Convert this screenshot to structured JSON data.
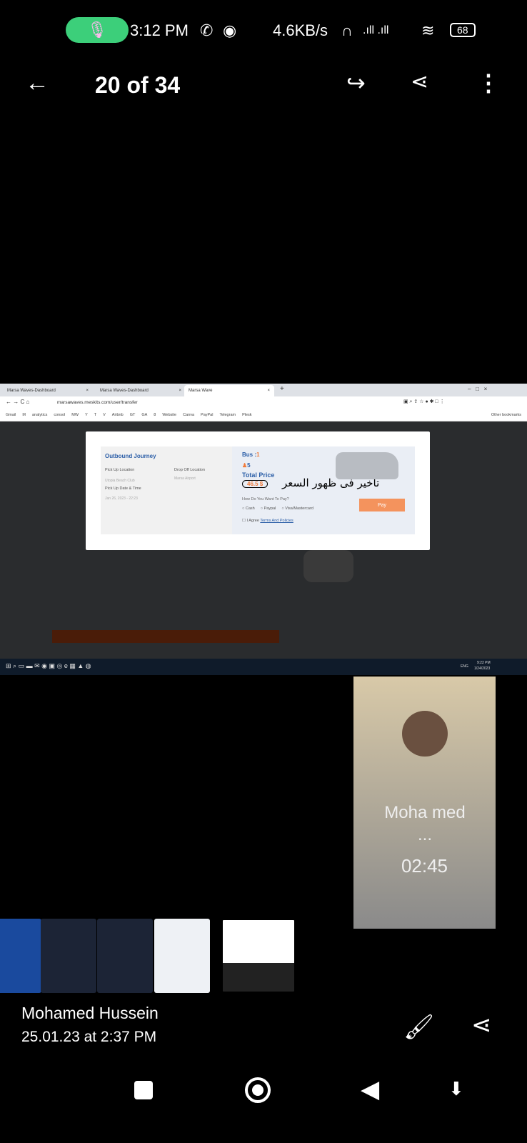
{
  "status_bar": {
    "time": "3:12 PM",
    "network_speed": "4.6KB/s",
    "battery": "68"
  },
  "viewer": {
    "counter": "20 of 34"
  },
  "browser": {
    "tabs": [
      {
        "label": "Marsa Waves-Dashboard"
      },
      {
        "label": "Marsa Waves-Dashboard"
      },
      {
        "label": "Marsa Wave"
      }
    ],
    "url": "marsawaves.meskits.com/user/transfer",
    "bookmarks": [
      "Gmail",
      "M",
      "analytics",
      "consol",
      "MW",
      "Y",
      "T",
      "V",
      "Airbnb",
      "GT",
      "GA",
      "8",
      "Website",
      "Canva",
      "PayPal",
      "Telegram",
      "Plesk"
    ],
    "other_bookmarks": "Other bookmarks"
  },
  "modal": {
    "title": "Outbound Journey",
    "pickup_label": "Pick Up Location",
    "pickup_value": "Utopia Beach Club",
    "dropoff_label": "Drop Off Location",
    "dropoff_value": "Marsa Airport",
    "datetime_label": "Pick Up Date & Time",
    "datetime_value": "Jan 26, 2023 - 22:23",
    "bus_label": "Bus :",
    "bus_value": "1",
    "passengers": "5",
    "total_label": "Total Price",
    "total_value": "46.5 $",
    "annotation": "تاخير فى ظهور السعر",
    "pay_question": "How Do You Want To Pay?",
    "pay_options": [
      "Cash",
      "Paypal",
      "Visa/Mastercard"
    ],
    "agree": "I Agree",
    "terms": "Terms And Policies",
    "pay_button": "Pay"
  },
  "taskbar": {
    "lang": "ENG",
    "time": "9:22 PM",
    "date": "1/24/2023"
  },
  "call": {
    "name": "Moha med ...",
    "duration": "02:45"
  },
  "footer": {
    "sender": "Mohamed Hussein",
    "date": "25.01.23 at 2:37 PM"
  }
}
